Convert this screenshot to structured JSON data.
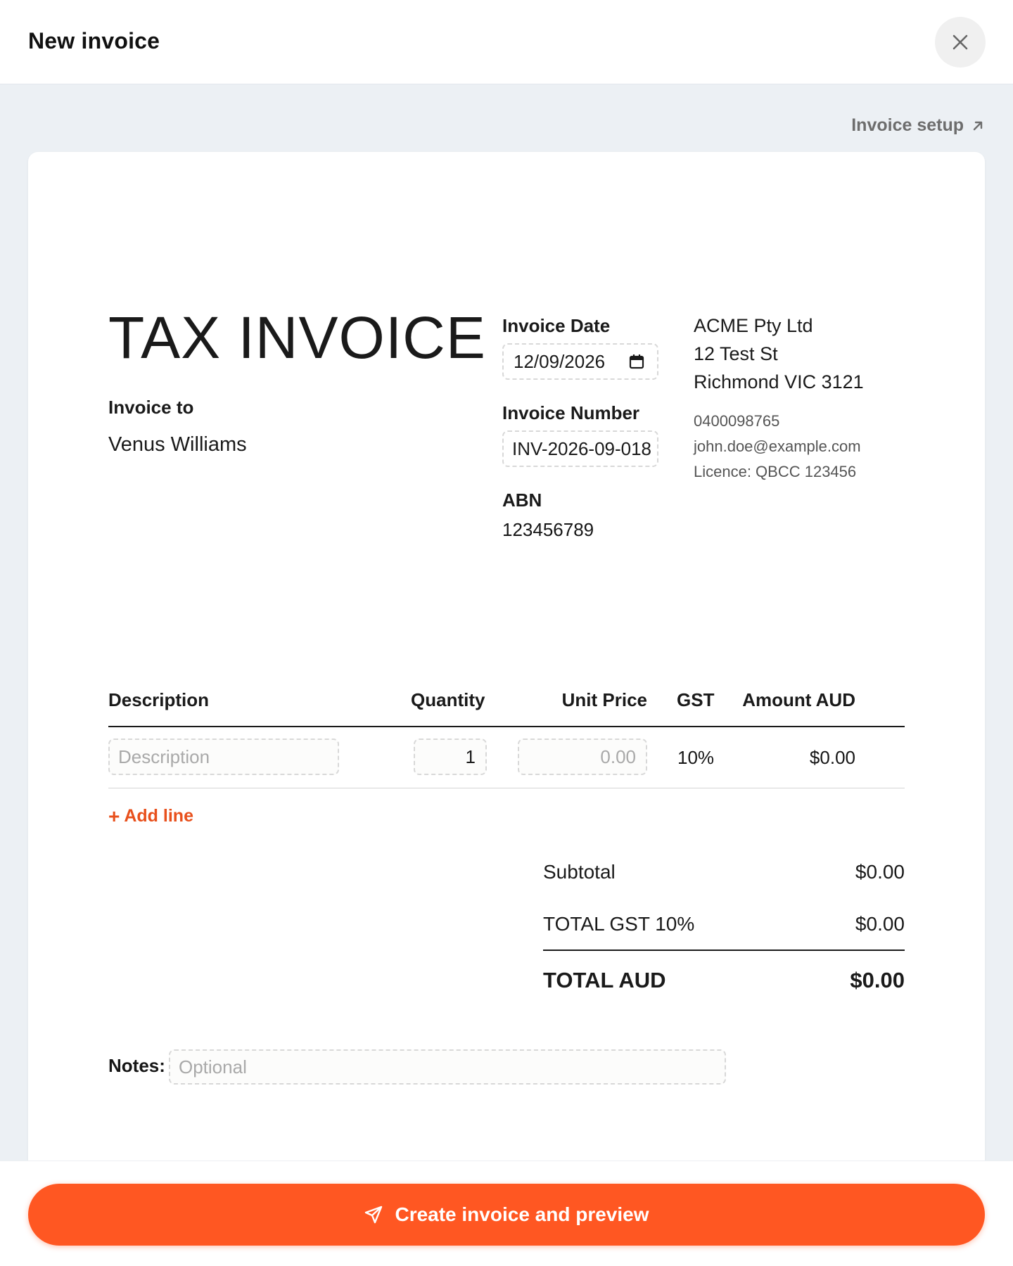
{
  "header": {
    "title": "New invoice",
    "close_icon": "close-icon"
  },
  "setup_link": {
    "label": "Invoice setup",
    "icon": "arrow-up-right-icon"
  },
  "invoice": {
    "title": "TAX INVOICE",
    "invoice_to_label": "Invoice to",
    "client_name": "Venus Williams",
    "date_label": "Invoice Date",
    "date_value": "12/09/2026",
    "number_label": "Invoice Number",
    "number_value": "INV-2026-09-018",
    "abn_label": "ABN",
    "abn_value": "123456789"
  },
  "company": {
    "name": "ACME Pty Ltd",
    "street": "12 Test St",
    "suburb": "Richmond VIC 3121",
    "phone": "0400098765",
    "email": "john.doe@example.com",
    "licence": "Licence: QBCC 123456"
  },
  "table": {
    "headers": [
      "Description",
      "Quantity",
      "Unit Price",
      "GST",
      "Amount AUD"
    ],
    "rows": [
      {
        "description_placeholder": "Description",
        "quantity": "1",
        "unit_price_placeholder": "0.00",
        "gst": "10%",
        "amount": "$0.00"
      }
    ],
    "add_line_label": "Add line"
  },
  "totals": {
    "subtotal_label": "Subtotal",
    "subtotal_value": "$0.00",
    "gst_label": "TOTAL GST 10%",
    "gst_value": "$0.00",
    "total_label": "TOTAL AUD",
    "total_value": "$0.00"
  },
  "notes": {
    "label": "Notes:",
    "placeholder": "Optional"
  },
  "footer": {
    "cta_label": "Create invoice and preview",
    "cta_icon": "send-icon"
  },
  "colors": {
    "accent": "#ff5722",
    "link_accent": "#e8501c",
    "page_bg": "#ecf0f4"
  }
}
